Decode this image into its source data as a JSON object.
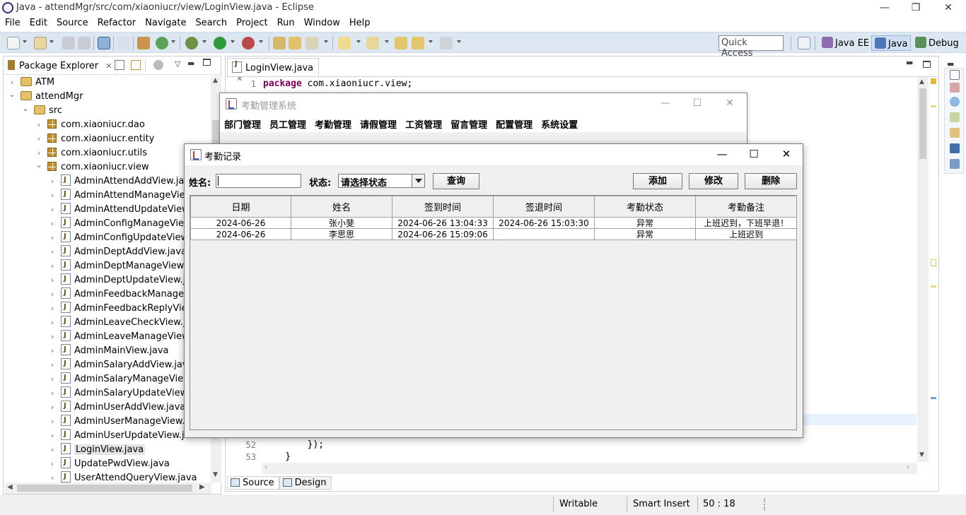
{
  "window": {
    "title": "Java - attendMgr/src/com/xiaoniucr/view/LoginView.java - Eclipse",
    "controls": [
      "—",
      "❐",
      "✕"
    ]
  },
  "menu": [
    "File",
    "Edit",
    "Source",
    "Refactor",
    "Navigate",
    "Search",
    "Project",
    "Run",
    "Window",
    "Help"
  ],
  "toolbar": {
    "quick_access": "Quick Access",
    "perspectives": [
      "Java EE",
      "Java",
      "Debug"
    ],
    "colors": {
      "bg": "#dde7f2",
      "active_perspective": "#cfe0f5"
    }
  },
  "package_explorer": {
    "tab_label": "Package Explorer",
    "tree": [
      {
        "label": "ATM",
        "type": "project",
        "depth": 0,
        "expanded": false
      },
      {
        "label": "attendMgr",
        "type": "project",
        "depth": 0,
        "expanded": true
      },
      {
        "label": "src",
        "type": "src",
        "depth": 1,
        "expanded": true
      },
      {
        "label": "com.xiaoniucr.dao",
        "type": "package",
        "depth": 2,
        "expanded": false
      },
      {
        "label": "com.xiaoniucr.entity",
        "type": "package",
        "depth": 2,
        "expanded": false
      },
      {
        "label": "com.xiaoniucr.utils",
        "type": "package",
        "depth": 2,
        "expanded": false
      },
      {
        "label": "com.xiaoniucr.view",
        "type": "package",
        "depth": 2,
        "expanded": true
      },
      {
        "label": "AdminAttendAddView.java",
        "type": "java",
        "depth": 3
      },
      {
        "label": "AdminAttendManageView.ja",
        "type": "java",
        "depth": 3
      },
      {
        "label": "AdminAttendUpdateView.ja",
        "type": "java",
        "depth": 3
      },
      {
        "label": "AdminConfigManageView.ja",
        "type": "java",
        "depth": 3
      },
      {
        "label": "AdminConfigUpdateView.ja",
        "type": "java",
        "depth": 3
      },
      {
        "label": "AdminDeptAddView.java",
        "type": "java",
        "depth": 3
      },
      {
        "label": "AdminDeptManageView.jav",
        "type": "java",
        "depth": 3
      },
      {
        "label": "AdminDeptUpdateView.jav",
        "type": "java",
        "depth": 3
      },
      {
        "label": "AdminFeedbackManageVie",
        "type": "java",
        "depth": 3
      },
      {
        "label": "AdminFeedbackReplyView.",
        "type": "java",
        "depth": 3
      },
      {
        "label": "AdminLeaveCheckView.java",
        "type": "java",
        "depth": 3
      },
      {
        "label": "AdminLeaveManageView.ja",
        "type": "java",
        "depth": 3
      },
      {
        "label": "AdminMainView.java",
        "type": "java",
        "depth": 3
      },
      {
        "label": "AdminSalaryAddView.java",
        "type": "java",
        "depth": 3
      },
      {
        "label": "AdminSalaryManageView.j",
        "type": "java",
        "depth": 3
      },
      {
        "label": "AdminSalaryUpdateView.ja",
        "type": "java",
        "depth": 3
      },
      {
        "label": "AdminUserAddView.java",
        "type": "java",
        "depth": 3
      },
      {
        "label": "AdminUserManageView.jav",
        "type": "java",
        "depth": 3
      },
      {
        "label": "AdminUserUpdateView.jav",
        "type": "java",
        "depth": 3
      },
      {
        "label": "LoginView.java",
        "type": "java",
        "depth": 3,
        "selected": true
      },
      {
        "label": "UpdatePwdView.java",
        "type": "java",
        "depth": 3
      },
      {
        "label": "UserAttendQueryView.java",
        "type": "java",
        "depth": 3
      }
    ]
  },
  "editor": {
    "tab_label": "LoginView.java",
    "lines": [
      {
        "num": "1",
        "keyword": "package",
        "rest": " com.xiaoniucr.view;"
      },
      {
        "num": "52",
        "keyword": "",
        "rest": "        });"
      },
      {
        "num": "53",
        "keyword": "",
        "rest": "    }"
      }
    ],
    "bottom_tabs": [
      "Source",
      "Design"
    ]
  },
  "statusbar": {
    "writable": "Writable",
    "insert_mode": "Smart Insert",
    "position": "50 : 18"
  },
  "swing_main": {
    "title": "考勤管理系统",
    "menu": [
      "部门管理",
      "员工管理",
      "考勤管理",
      "请假管理",
      "工资管理",
      "留言管理",
      "配置管理",
      "系统设置"
    ]
  },
  "dialog": {
    "title": "考勤记录",
    "name_label": "姓名:",
    "name_value": "",
    "status_label": "状态:",
    "status_selected": "请选择状态",
    "query_button": "查询",
    "add_button": "添加",
    "edit_button": "修改",
    "delete_button": "删除",
    "table": {
      "columns": [
        "日期",
        "姓名",
        "签到时间",
        "签退时间",
        "考勤状态",
        "考勤备注"
      ],
      "rows": [
        [
          "2024-06-26",
          "张小斐",
          "2024-06-26 13:04:33",
          "2024-06-26 15:03:30",
          "异常",
          "上班迟到，下班早退！"
        ],
        [
          "2024-06-26",
          "李思思",
          "2024-06-26 15:09:06",
          "",
          "异常",
          "上班迟到"
        ]
      ]
    }
  }
}
